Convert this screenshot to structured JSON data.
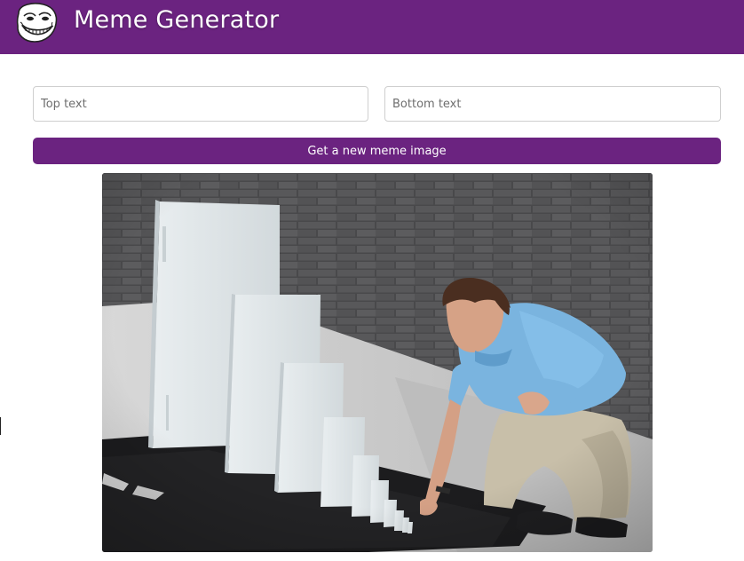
{
  "app": {
    "title": "Meme Generator"
  },
  "form": {
    "top_placeholder": "Top text",
    "bottom_placeholder": "Bottom text",
    "top_value": "",
    "bottom_value": ""
  },
  "actions": {
    "new_image_label": "Get a new meme image"
  },
  "colors": {
    "brand": "#6b2380",
    "header_text": "#ffffff",
    "button_text": "#ffffff"
  },
  "icons": {
    "logo": "trollface-logo-icon"
  }
}
